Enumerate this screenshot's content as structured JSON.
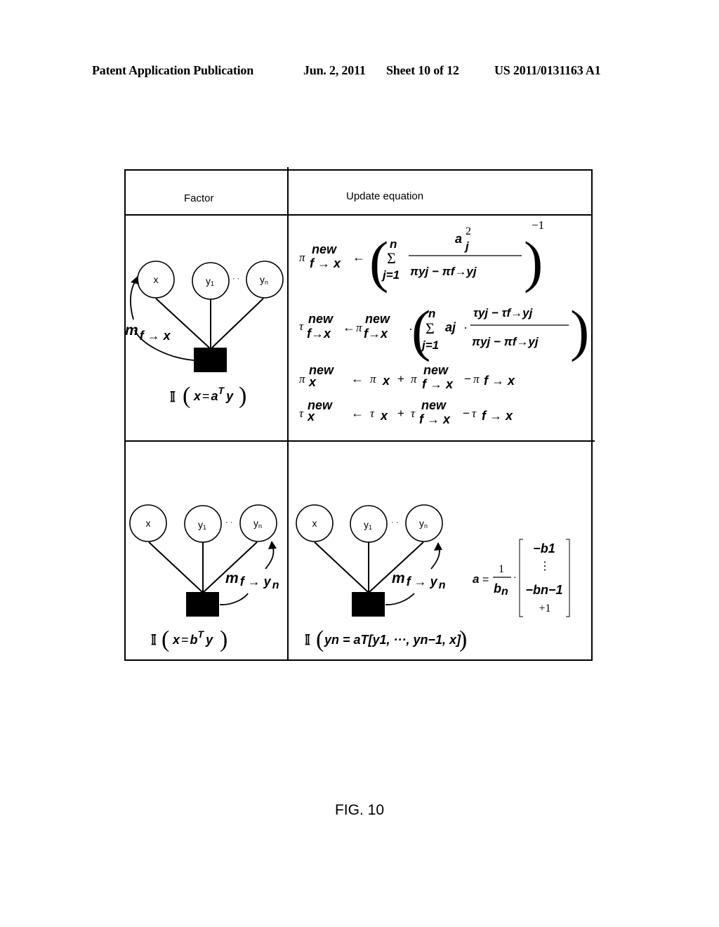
{
  "header": {
    "publication": "Patent Application Publication",
    "date": "Jun. 2, 2011",
    "sheet": "Sheet 10 of 12",
    "number": "US 2011/0131163 A1"
  },
  "table": {
    "col_factor": "Factor",
    "col_update": "Update equation",
    "rows": [
      {
        "diagram": {
          "nodes": [
            "x",
            "y",
            "y"
          ],
          "node_subscripts": [
            "",
            "1",
            "n"
          ],
          "ellipsis": "· ·",
          "message": {
            "m": "m",
            "sub": "f → x"
          },
          "indicator": "𝕀",
          "constraint": {
            "lhs": "x",
            "eq": "=",
            "vec": "a",
            "sup": "T",
            "rhs": "y"
          }
        },
        "equations": [
          {
            "name": "pi-f-to-x",
            "lhs": "π",
            "lhs_sup": "new",
            "lhs_sub": "f → x",
            "arrow": "←",
            "sum_top": "n",
            "sum": "Σ",
            "sum_bot": "j=1",
            "num": "a",
            "num_sup": "2",
            "num_sub": "j",
            "den": "πyj − πf→yj",
            "power": "−1"
          },
          {
            "name": "tau-f-to-x",
            "lhs": "τ",
            "lhs_sup": "new",
            "lhs_sub": "f→x",
            "arrow": "←",
            "rhs_pre": "π",
            "rhs_sup": "new",
            "rhs_sub": "f→x",
            "dot": "·",
            "sum_top": "n",
            "sum": "Σ",
            "sum_bot": "j=1",
            "coef": "aj",
            "num": "τyj − τf→yj",
            "den": "πyj − πf→yj"
          },
          {
            "name": "pi-x",
            "text": "π x new ← π x + π f→x new − π f→x"
          },
          {
            "name": "tau-x",
            "text": "τ x new ← τ x + τ f→x new − τ f→x"
          }
        ]
      },
      {
        "diagram": {
          "nodes": [
            "x",
            "y",
            "y"
          ],
          "node_subscripts": [
            "",
            "1",
            "n"
          ],
          "ellipsis": "· ·",
          "message": {
            "m": "m",
            "sub": "f → y",
            "subsub": "n"
          },
          "indicator": "𝕀",
          "constraint": {
            "lhs": "x",
            "eq": "=",
            "vec": "b",
            "sup": "T",
            "rhs": "y"
          }
        },
        "update_diagram": {
          "nodes": [
            "x",
            "y",
            "y"
          ],
          "node_subscripts": [
            "",
            "1",
            "n"
          ],
          "ellipsis": "· ·",
          "message": {
            "m": "m",
            "sub": "f → y",
            "subsub": "n"
          },
          "indicator": "𝕀",
          "constraint": "yn = aT[y1, ···, yn−1, x]"
        },
        "a_definition": {
          "lhs": "a",
          "eq": "=",
          "num": "1",
          "den": "b",
          "den_sub": "n",
          "dot": "·",
          "vector": [
            "−b1",
            "⋮",
            "−bn−1",
            "+1"
          ]
        }
      }
    ]
  },
  "figure_label": "FIG. 10"
}
